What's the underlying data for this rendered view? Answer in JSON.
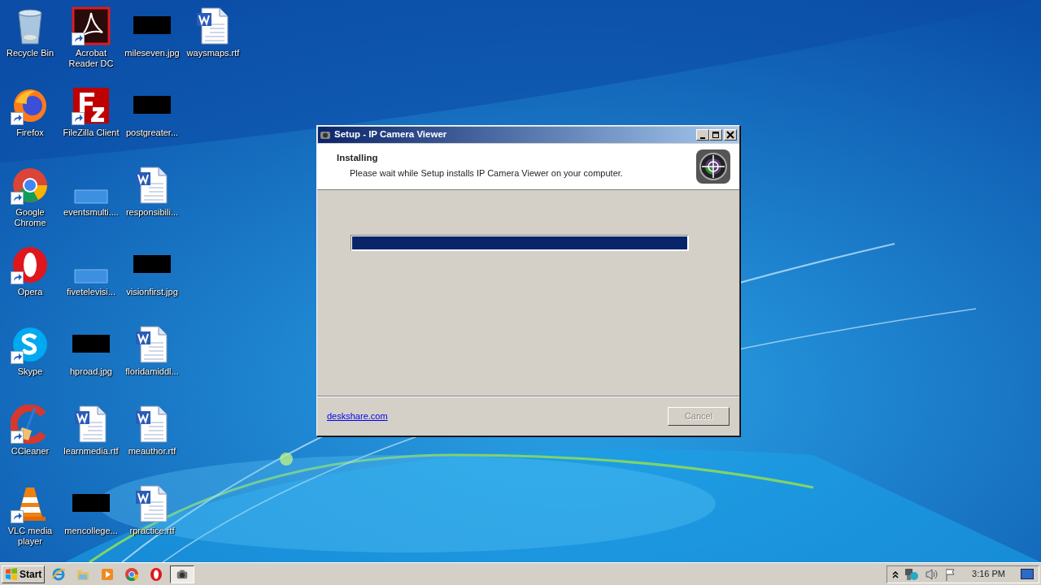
{
  "desktop_icons": [
    {
      "label": "Recycle Bin",
      "kind": "recycle",
      "shortcut": false
    },
    {
      "label": "Firefox",
      "kind": "firefox",
      "shortcut": true
    },
    {
      "label": "Google Chrome",
      "kind": "chrome",
      "shortcut": true
    },
    {
      "label": "Opera",
      "kind": "opera",
      "shortcut": true
    },
    {
      "label": "Skype",
      "kind": "skype",
      "shortcut": true
    },
    {
      "label": "CCleaner",
      "kind": "ccleaner",
      "shortcut": true
    },
    {
      "label": "VLC media player",
      "kind": "vlc",
      "shortcut": true
    },
    {
      "label": "Acrobat Reader DC",
      "kind": "acrobat",
      "shortcut": true
    },
    {
      "label": "FileZilla Client",
      "kind": "filezilla",
      "shortcut": true
    },
    {
      "label": "eventsmulti....",
      "kind": "blank",
      "shortcut": false
    },
    {
      "label": "fivetelevisi...",
      "kind": "blank",
      "shortcut": false
    },
    {
      "label": "hproad.jpg",
      "shortcut": false
    },
    {
      "label": "learnmedia.rtf",
      "kind": "word",
      "shortcut": false
    },
    {
      "label": "mencollege...",
      "shortcut": false
    },
    {
      "label": "mileseven.jpg",
      "shortcut": false
    },
    {
      "label": "postgreater...",
      "shortcut": false
    },
    {
      "label": "responsibili...",
      "kind": "word",
      "shortcut": false
    },
    {
      "label": "visionfirst.jpg",
      "shortcut": false
    },
    {
      "label": "floridamiddl...",
      "kind": "word",
      "shortcut": false
    },
    {
      "label": "meauthor.rtf",
      "kind": "word",
      "shortcut": false
    },
    {
      "label": "rpractice.rtf",
      "kind": "word",
      "shortcut": false
    },
    {
      "label": "waysmaps.rtf",
      "kind": "word",
      "shortcut": false
    }
  ],
  "dialog": {
    "title": "Setup - IP Camera Viewer",
    "heading": "Installing",
    "subheading": "Please wait while Setup installs IP Camera Viewer on your computer.",
    "progress": {
      "level": 1
    },
    "link": "deskshare.com",
    "buttons": [
      {
        "label": "Cancel",
        "disabled": true
      }
    ]
  },
  "taskbar": {
    "start": "Start",
    "quick_launch": [
      {
        "kind": "ie"
      },
      {
        "kind": "folder"
      },
      {
        "kind": "media"
      },
      {
        "kind": "chrome"
      },
      {
        "kind": "opera"
      }
    ],
    "tasks": [
      {
        "kind": "camera",
        "selected": true
      }
    ],
    "clock": "3:16 PM"
  }
}
